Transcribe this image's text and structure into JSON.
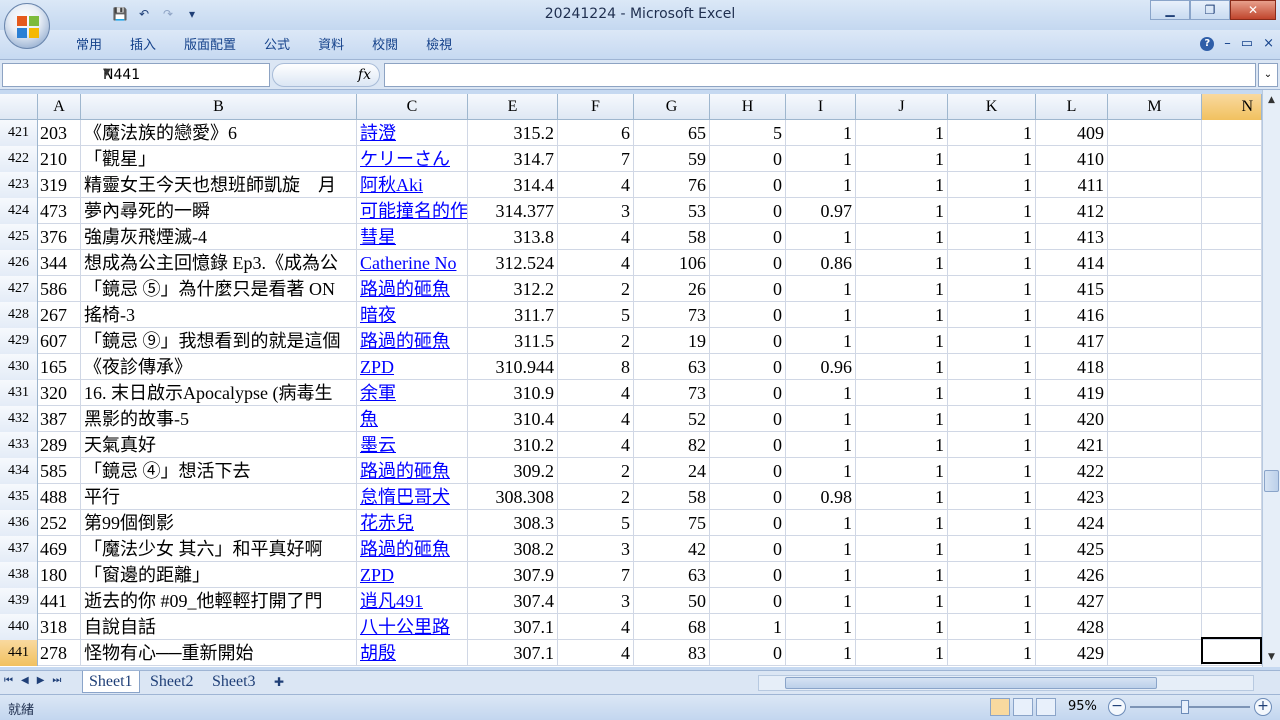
{
  "window": {
    "title": "20241224 - Microsoft Excel",
    "minimize": "▁",
    "restore": "❐",
    "close": "✕"
  },
  "qat": {
    "save": "💾",
    "undo": "↶",
    "redo": "↷",
    "more": "▾"
  },
  "ribbon": {
    "tabs": [
      "常用",
      "插入",
      "版面配置",
      "公式",
      "資料",
      "校閱",
      "檢視"
    ],
    "help": "?",
    "min": "–",
    "restore": "▭",
    "close": "×"
  },
  "formula_bar": {
    "name_box": "N441",
    "fx": "fx",
    "content": ""
  },
  "columns": [
    "A",
    "B",
    "C",
    "E",
    "F",
    "G",
    "H",
    "I",
    "J",
    "K",
    "L",
    "M",
    "N"
  ],
  "selected_column": "N",
  "rows": [
    {
      "n": "421",
      "A": "203",
      "B": "《魔法族的戀愛》6",
      "C": "詩澄",
      "E": "315.2",
      "F": "6",
      "G": "65",
      "H": "5",
      "I": "1",
      "J": "1",
      "K": "1",
      "L": "409"
    },
    {
      "n": "422",
      "A": "210",
      "B": "「觀星」",
      "C": "ケリーさん",
      "E": "314.7",
      "F": "7",
      "G": "59",
      "H": "0",
      "I": "1",
      "J": "1",
      "K": "1",
      "L": "410"
    },
    {
      "n": "423",
      "A": "319",
      "B": "精靈女王今天也想班師凱旋　月",
      "C": "阿秋Aki",
      "E": "314.4",
      "F": "4",
      "G": "76",
      "H": "0",
      "I": "1",
      "J": "1",
      "K": "1",
      "L": "411"
    },
    {
      "n": "424",
      "A": "473",
      "B": "夢內尋死的一瞬",
      "C": "可能撞名的作",
      "E": "314.377",
      "F": "3",
      "G": "53",
      "H": "0",
      "I": "0.97",
      "J": "1",
      "K": "1",
      "L": "412"
    },
    {
      "n": "425",
      "A": "376",
      "B": "強虜灰飛煙滅-4",
      "C": "彗星",
      "E": "313.8",
      "F": "4",
      "G": "58",
      "H": "0",
      "I": "1",
      "J": "1",
      "K": "1",
      "L": "413"
    },
    {
      "n": "426",
      "A": "344",
      "B": "想成為公主回憶錄 Ep3.《成為公",
      "C": "Catherine No",
      "E": "312.524",
      "F": "4",
      "G": "106",
      "H": "0",
      "I": "0.86",
      "J": "1",
      "K": "1",
      "L": "414"
    },
    {
      "n": "427",
      "A": "586",
      "B": "「鏡忌 ⑤」為什麼只是看著 ON",
      "C": "路過的砸魚",
      "E": "312.2",
      "F": "2",
      "G": "26",
      "H": "0",
      "I": "1",
      "J": "1",
      "K": "1",
      "L": "415"
    },
    {
      "n": "428",
      "A": "267",
      "B": "搖椅-3",
      "C": "暗夜",
      "E": "311.7",
      "F": "5",
      "G": "73",
      "H": "0",
      "I": "1",
      "J": "1",
      "K": "1",
      "L": "416"
    },
    {
      "n": "429",
      "A": "607",
      "B": "「鏡忌 ⑨」我想看到的就是這個",
      "C": "路過的砸魚",
      "E": "311.5",
      "F": "2",
      "G": "19",
      "H": "0",
      "I": "1",
      "J": "1",
      "K": "1",
      "L": "417"
    },
    {
      "n": "430",
      "A": "165",
      "B": "《夜診傳承》",
      "C": "ZPD",
      "E": "310.944",
      "F": "8",
      "G": "63",
      "H": "0",
      "I": "0.96",
      "J": "1",
      "K": "1",
      "L": "418"
    },
    {
      "n": "431",
      "A": "320",
      "B": "16. 末日啟示Apocalypse (病毒生",
      "C": "余軍",
      "E": "310.9",
      "F": "4",
      "G": "73",
      "H": "0",
      "I": "1",
      "J": "1",
      "K": "1",
      "L": "419"
    },
    {
      "n": "432",
      "A": "387",
      "B": "黑影的故事-5",
      "C": "魚",
      "E": "310.4",
      "F": "4",
      "G": "52",
      "H": "0",
      "I": "1",
      "J": "1",
      "K": "1",
      "L": "420"
    },
    {
      "n": "433",
      "A": "289",
      "B": "天氣真好",
      "C": "墨云",
      "E": "310.2",
      "F": "4",
      "G": "82",
      "H": "0",
      "I": "1",
      "J": "1",
      "K": "1",
      "L": "421"
    },
    {
      "n": "434",
      "A": "585",
      "B": "「鏡忌 ④」想活下去",
      "C": "路過的砸魚",
      "E": "309.2",
      "F": "2",
      "G": "24",
      "H": "0",
      "I": "1",
      "J": "1",
      "K": "1",
      "L": "422"
    },
    {
      "n": "435",
      "A": "488",
      "B": "平行",
      "C": "怠惰巴哥犬",
      "E": "308.308",
      "F": "2",
      "G": "58",
      "H": "0",
      "I": "0.98",
      "J": "1",
      "K": "1",
      "L": "423"
    },
    {
      "n": "436",
      "A": "252",
      "B": "第99個倒影",
      "C": "花赤兒",
      "E": "308.3",
      "F": "5",
      "G": "75",
      "H": "0",
      "I": "1",
      "J": "1",
      "K": "1",
      "L": "424"
    },
    {
      "n": "437",
      "A": "469",
      "B": "「魔法少女 其六」和平真好啊",
      "C": "路過的砸魚",
      "E": "308.2",
      "F": "3",
      "G": "42",
      "H": "0",
      "I": "1",
      "J": "1",
      "K": "1",
      "L": "425"
    },
    {
      "n": "438",
      "A": "180",
      "B": "「窗邊的距離」",
      "C": "ZPD",
      "E": "307.9",
      "F": "7",
      "G": "63",
      "H": "0",
      "I": "1",
      "J": "1",
      "K": "1",
      "L": "426"
    },
    {
      "n": "439",
      "A": "441",
      "B": "逝去的你 #09_他輕輕打開了門",
      "C": "逍凡491",
      "E": "307.4",
      "F": "3",
      "G": "50",
      "H": "0",
      "I": "1",
      "J": "1",
      "K": "1",
      "L": "427"
    },
    {
      "n": "440",
      "A": "318",
      "B": "自說自話",
      "C": "八十公里路",
      "E": "307.1",
      "F": "4",
      "G": "68",
      "H": "1",
      "I": "1",
      "J": "1",
      "K": "1",
      "L": "428"
    },
    {
      "n": "441",
      "A": "278",
      "B": "怪物有心──重新開始",
      "C": "胡殷",
      "E": "307.1",
      "F": "4",
      "G": "83",
      "H": "0",
      "I": "1",
      "J": "1",
      "K": "1",
      "L": "429"
    }
  ],
  "sheets": [
    "Sheet1",
    "Sheet2",
    "Sheet3"
  ],
  "active_sheet": "Sheet1",
  "status": {
    "text": "就緒",
    "zoom": "95%"
  },
  "colors": {
    "link": "#0000ff",
    "selected_header": "#f1c15f",
    "ribbon": "#c6d9f1"
  }
}
